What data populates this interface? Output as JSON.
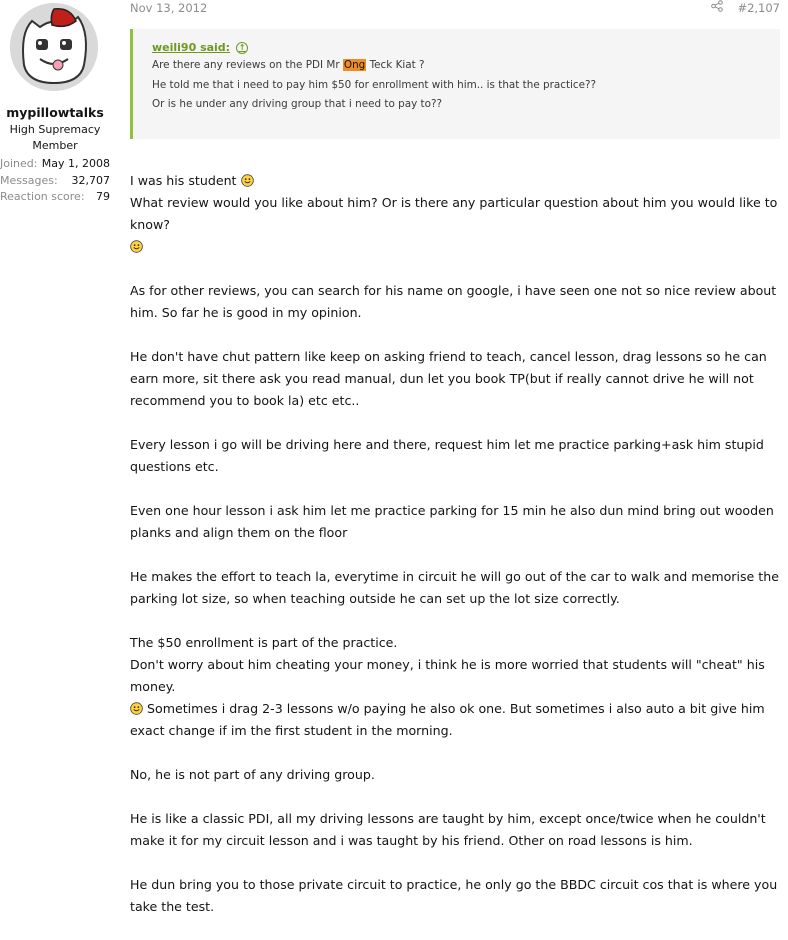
{
  "user": {
    "name": "mypillowtalks",
    "title_line1": "High Supremacy",
    "title_line2": "Member",
    "stats": [
      {
        "label": "Joined:",
        "value": "May 1, 2008"
      },
      {
        "label": "Messages:",
        "value": "32,707"
      },
      {
        "label": "Reaction score:",
        "value": "79"
      }
    ]
  },
  "post": {
    "date": "Nov 13, 2012",
    "number": "#2,107"
  },
  "quote": {
    "author": "weili90 said:",
    "line1_pre": "Are there any reviews on the PDI Mr ",
    "line1_hl": "Ong",
    "line1_post": " Teck Kiat ?",
    "line2": "He told me that i need to pay him $50 for enrollment with him.. is that the practice??",
    "line3": "Or is he under any driving group that i need to pay to??"
  },
  "body": {
    "p1a": "I was his student",
    "p1b": "What review would you like about him? Or is there any particular question about him you would like to know?",
    "p2": "As for other reviews, you can search for his name on google, i have seen one not so nice review about him. So far he is good in my opinion.",
    "p3": "He don't have chut pattern like keep on asking friend to teach, cancel lesson, drag lessons so he can earn more, sit there ask you read manual, dun let you book TP(but if really cannot drive he will not recommend you to book la) etc etc..",
    "p4": "Every lesson i go will be driving here and there, request him let me practice parking+ask him stupid questions etc.",
    "p5": "Even one hour lesson i ask him let me practice parking for 15 min he also dun mind bring out wooden planks and align them on the floor",
    "p6": "He makes the effort to teach la, everytime in circuit he will go out of the car to walk and memorise the parking lot size, so when teaching outside he can set up the lot size correctly.",
    "p7a": "The $50 enrollment is part of the practice.",
    "p7b": "Don't worry about him cheating your money, i think he is more worried that students will \"cheat\" his money.",
    "p7c": "Sometimes i drag 2-3 lessons w/o paying he also ok one. But sometimes i also auto a bit give him exact change if im the first student in the morning.",
    "p8": "No, he is not part of any driving group.",
    "p9": "He is like a classic PDI, all my driving lessons are taught by him, except once/twice when he couldn't make it for my circuit lesson and i was taught by his friend. Other on road lessons is him.",
    "p10": "He dun bring you to those private circuit to practice, he only go the BBDC circuit cos that is where you take the test."
  },
  "icons": {
    "share": "share-icon",
    "smile": "smile-icon",
    "quote_jump": "arrow-up-circle-icon"
  },
  "colors": {
    "quote_border": "#8fc13e",
    "quote_author": "#6b9a1f",
    "highlight": "#f08c28",
    "muted": "#8c8c8c"
  }
}
